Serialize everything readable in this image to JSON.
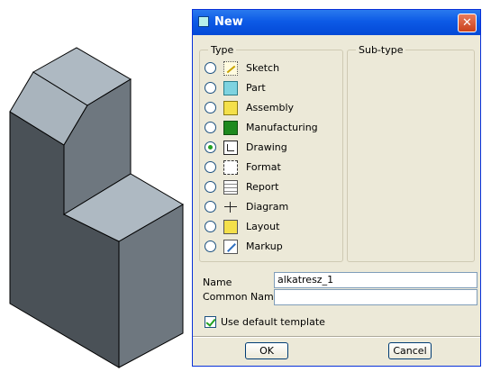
{
  "dialog": {
    "title": "New",
    "close_symbol": "✕",
    "type_group_label": "Type",
    "subtype_group_label": "Sub-type",
    "types": [
      {
        "label": "Sketch",
        "icon": "sketch-icon",
        "selected": false
      },
      {
        "label": "Part",
        "icon": "part-icon",
        "selected": false
      },
      {
        "label": "Assembly",
        "icon": "assembly-icon",
        "selected": false
      },
      {
        "label": "Manufacturing",
        "icon": "manufacturing-icon",
        "selected": false
      },
      {
        "label": "Drawing",
        "icon": "drawing-icon",
        "selected": true
      },
      {
        "label": "Format",
        "icon": "format-icon",
        "selected": false
      },
      {
        "label": "Report",
        "icon": "report-icon",
        "selected": false
      },
      {
        "label": "Diagram",
        "icon": "diagram-icon",
        "selected": false
      },
      {
        "label": "Layout",
        "icon": "layout-icon",
        "selected": false
      },
      {
        "label": "Markup",
        "icon": "markup-icon",
        "selected": false
      }
    ],
    "name_label": "Name",
    "name_value": "alkatresz_1",
    "common_name_label": "Common Name",
    "common_name_value": "",
    "use_default_template_label": "Use default template",
    "use_default_template_checked": true,
    "ok_label": "OK",
    "cancel_label": "Cancel"
  },
  "colors": {
    "titlebar": "#0d5ae6",
    "dialog_bg": "#ece9d8",
    "model_top": "#a9b4bd",
    "model_left": "#4a5157",
    "model_right": "#6e777f"
  }
}
